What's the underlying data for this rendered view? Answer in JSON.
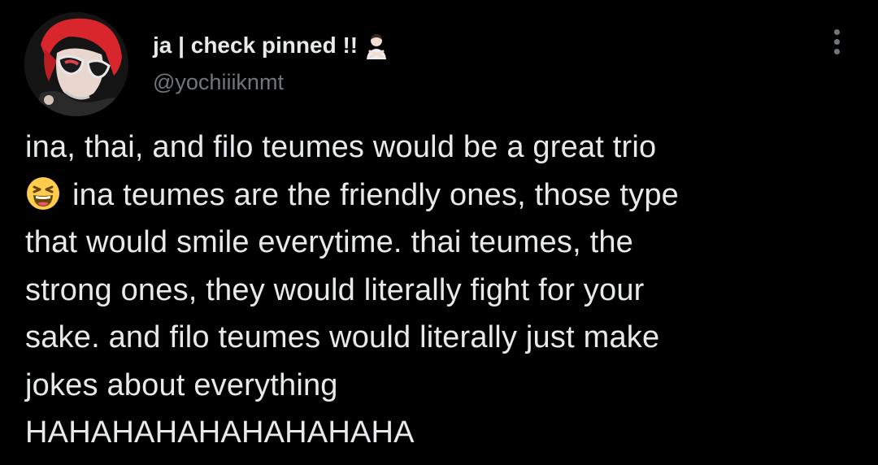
{
  "tweet": {
    "author": {
      "display_name": "ja | check pinned !!",
      "display_name_emoji": "person-gesturing-no-emoji",
      "handle": "@yochiiiknmt",
      "avatar": "profile-photo"
    },
    "more_icon": "more-options-icon",
    "text_lines": [
      "ina, thai, and filo teumes would be a great trio",
      "ina teumes are the friendly ones, those type",
      "that would smile everytime. thai teumes, the",
      "strong ones, they would literally fight for your",
      "sake. and filo teumes would literally just make",
      "jokes about everything",
      "HAHAHAHAHAHAHAHAHA"
    ],
    "inline_emoji": "grinning-squinting-face-emoji"
  },
  "colors": {
    "background": "#000000",
    "primary_text": "#e7e9ea",
    "secondary_text": "#71767b"
  }
}
